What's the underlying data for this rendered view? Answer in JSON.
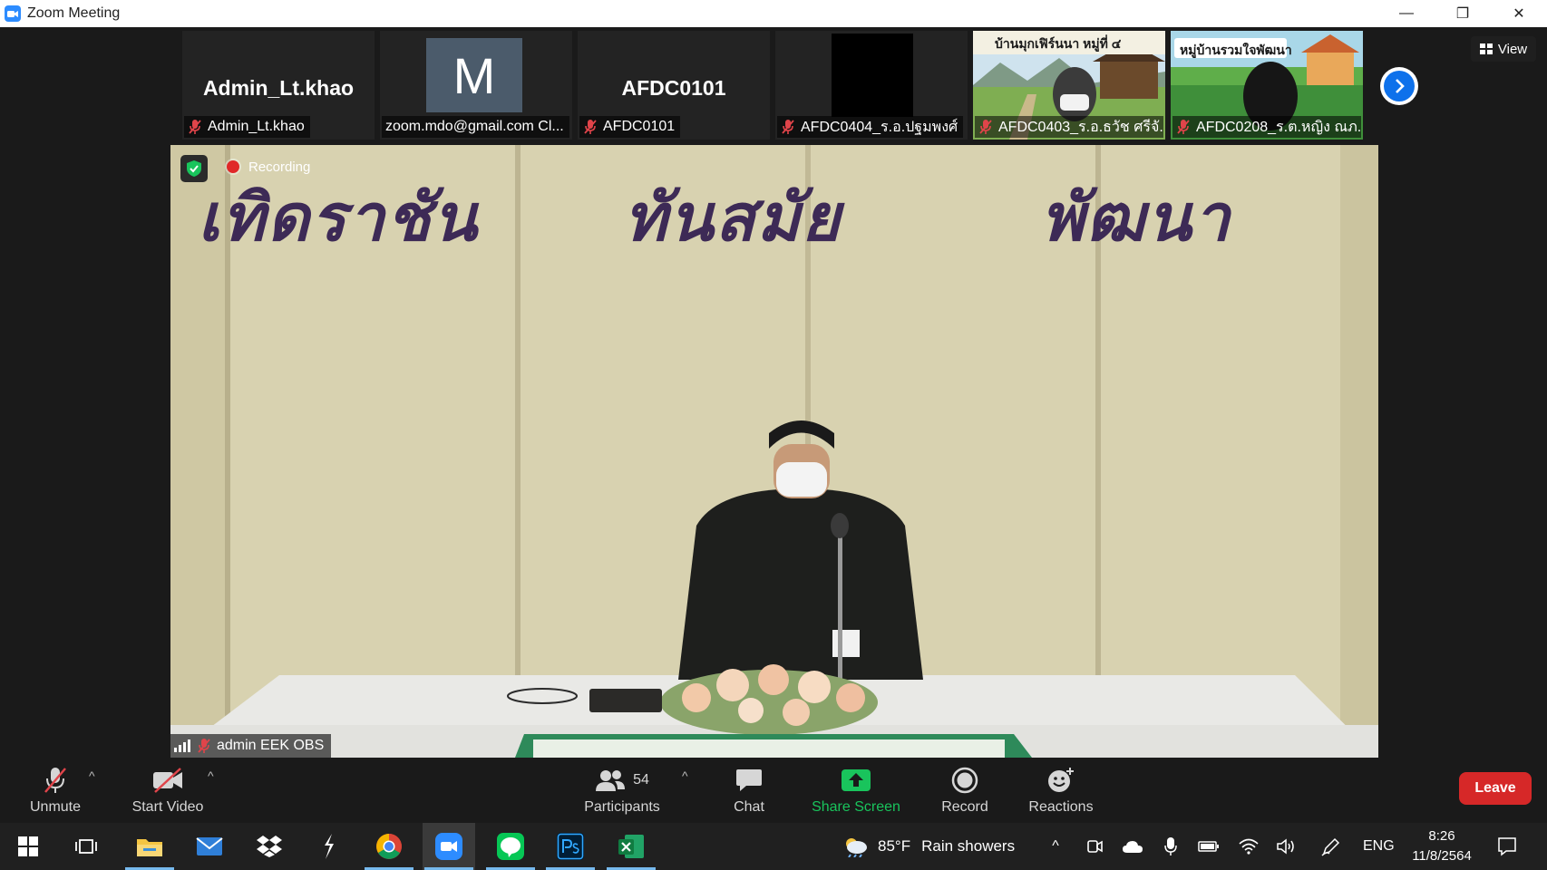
{
  "window": {
    "title": "Zoom Meeting",
    "minimize": "—",
    "restore": "❐",
    "close": "✕"
  },
  "thumbnails": [
    {
      "big_name": "Admin_Lt.khao",
      "label": "Admin_Lt.khao",
      "muted": true
    },
    {
      "avatar_letter": "M",
      "label": "zoom.mdo@gmail.com Cl...",
      "muted": false
    },
    {
      "big_name": "AFDC0101",
      "label": "AFDC0101",
      "muted": true
    },
    {
      "label": "AFDC0404_ร.อ.ปฐมพงศ์",
      "muted": true
    },
    {
      "scene_text": "บ้านมุกเฟิร์นนา หมู่ที่ ๔",
      "label": "AFDC0403_ร.อ.ธวัช ศรีจั...",
      "muted": true
    },
    {
      "scene_text": "หมู่บ้านรวมใจพัฒนา",
      "label": "AFDC0208_ร.ต.หญิง ณภ...",
      "muted": true
    }
  ],
  "view_button": {
    "label": "View"
  },
  "main_video": {
    "banner_words": [
      "เทิดราชัน",
      "ทันสมัย",
      "พัฒนา"
    ],
    "recording_label": "Recording",
    "speaker_name": "admin EEK OBS"
  },
  "toolbar": {
    "unmute": "Unmute",
    "start_video": "Start Video",
    "participants": "Participants",
    "participants_count": "54",
    "chat": "Chat",
    "share_screen": "Share Screen",
    "record": "Record",
    "reactions": "Reactions",
    "leave": "Leave",
    "caret": "^"
  },
  "taskbar": {
    "weather_temp": "85°F",
    "weather_text": "Rain showers",
    "language": "ENG",
    "time": "8:26",
    "date": "11/8/2564",
    "tray_expand": "^"
  },
  "colors": {
    "zoom_blue": "#2d8cff",
    "share_green": "#19c45c",
    "leave_red": "#d62828",
    "mute_red": "#e0444a"
  }
}
